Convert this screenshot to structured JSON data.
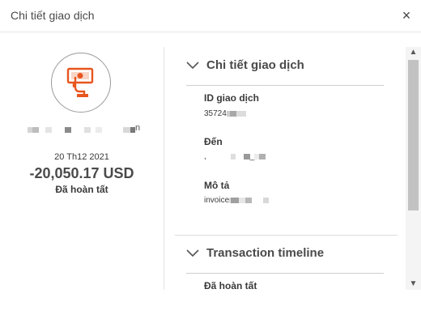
{
  "window": {
    "title": "Chi tiết giao dịch",
    "close_icon": "×"
  },
  "summary": {
    "date": "20 Th12 2021",
    "amount": "-20,050.17 USD",
    "status": "Đã hoàn tất",
    "icon": "payment-hand-icon",
    "icon_color": "#e8561f",
    "name_suffix": "n"
  },
  "details": {
    "section_title": "Chi tiết giao dịch",
    "fields": [
      {
        "label": "ID giao dịch",
        "value": "35724"
      },
      {
        "label": "Đến",
        "value": ",",
        "value_tail": "_"
      },
      {
        "label": "Mô tả",
        "value": "invoice"
      }
    ]
  },
  "timeline": {
    "section_title": "Transaction timeline",
    "first_item": "Đã hoàn tất"
  },
  "scrollbar": {
    "up_icon": "▲",
    "down_icon": "▼"
  }
}
